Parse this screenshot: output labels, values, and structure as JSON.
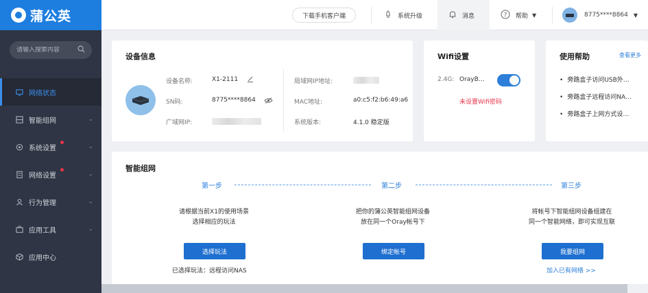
{
  "app": {
    "name": "蒲公英"
  },
  "search": {
    "placeholder": "请输入搜索内容"
  },
  "sidebar": {
    "items": [
      {
        "label": "网络状态",
        "icon": "monitor-icon"
      },
      {
        "label": "智能组网",
        "icon": "network-icon"
      },
      {
        "label": "系统设置",
        "icon": "gear-icon"
      },
      {
        "label": "网络设置",
        "icon": "document-icon"
      },
      {
        "label": "行为管理",
        "icon": "user-icon"
      },
      {
        "label": "应用工具",
        "icon": "briefcase-icon"
      },
      {
        "label": "应用中心",
        "icon": "cube-icon"
      }
    ]
  },
  "topbar": {
    "download": "下载手机客户端",
    "upgrade": "系统升级",
    "messages": "消息",
    "help": "帮助",
    "account": "8775****8864"
  },
  "device_info": {
    "title": "设备信息",
    "name_label": "设备名称:",
    "name_value": "X1-2111",
    "sn_label": "SN码:",
    "sn_value": "8775****8864",
    "wan_label": "广域网IP:",
    "lan_label": "局域网IP地址:",
    "mac_label": "MAC地址:",
    "mac_value": "a0:c5:f2:b6:49:a6",
    "version_label": "系统版本:",
    "version_value": "4.1.0 稳定版"
  },
  "wifi": {
    "title": "Wifi设置",
    "band": "2.4G:",
    "ssid": "OrayB…",
    "enabled": true,
    "warning": "未设置Wifi密码"
  },
  "help_card": {
    "title": "使用帮助",
    "more": "查看更多",
    "items": [
      "旁路盒子访问USB外…",
      "旁路盒子远程访问NA…",
      "旁路盒子上网方式设…"
    ]
  },
  "smart_network": {
    "title": "智能组网",
    "steps": [
      {
        "title": "第一步",
        "desc1": "请根据当前X1的使用场景",
        "desc2": "选择相应的玩法",
        "button": "选择玩法",
        "note": "已选择玩法：远程访问NAS"
      },
      {
        "title": "第二步",
        "desc1": "把你的蒲公英智能组网设备",
        "desc2": "放在同一个Oray帐号下",
        "button": "绑定帐号"
      },
      {
        "title": "第三步",
        "desc1": "将帐号下智能组网设备组建在",
        "desc2": "同一个智能网络，即可实现互联",
        "button": "我要组网",
        "link": "加入已有网络 >>"
      }
    ]
  },
  "colors": {
    "accent": "#1e7ee0",
    "sidebar": "#2f3544",
    "warning": "#e7334a",
    "button": "#1e6fd0"
  }
}
